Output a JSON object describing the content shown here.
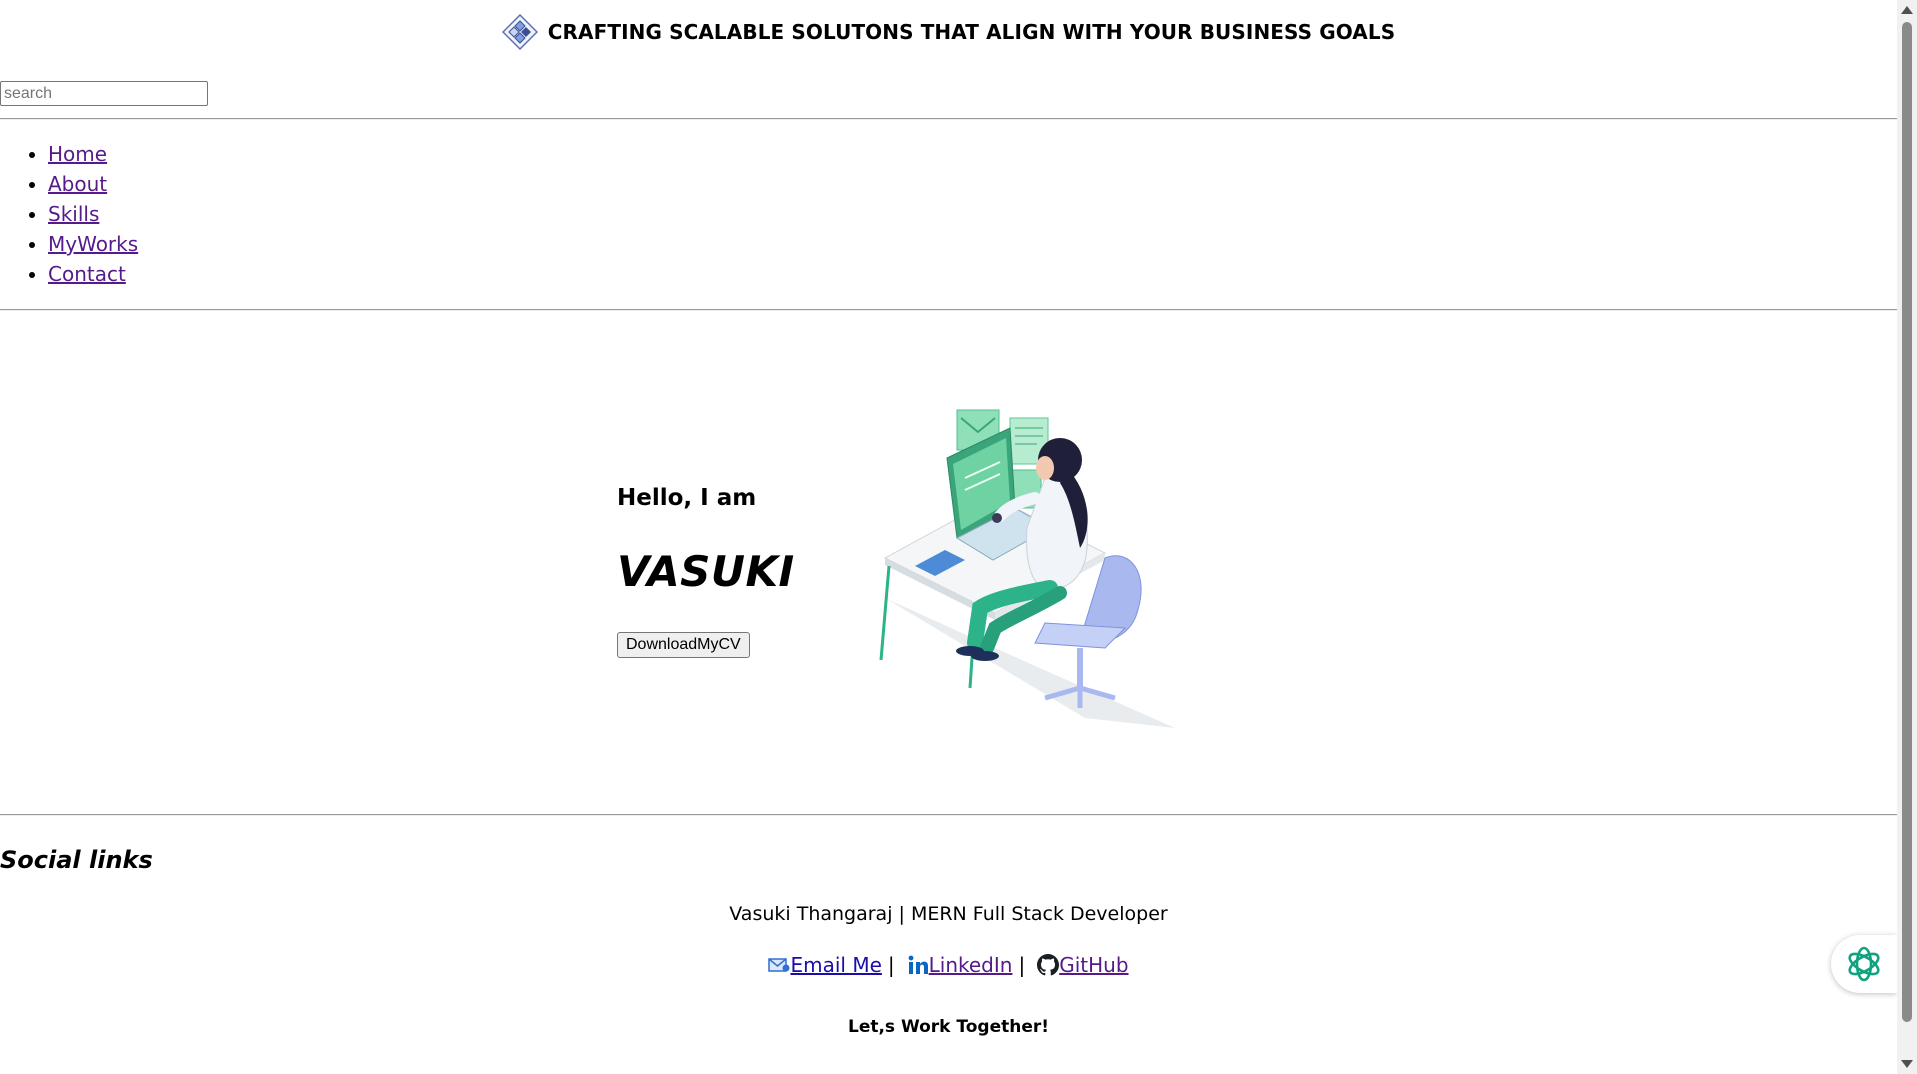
{
  "header": {
    "tagline": "CRAFTING SCALABLE SOLUTONS THAT ALIGN WITH YOUR BUSINESS GOALS",
    "logo_icon": "diamond-logo-icon"
  },
  "search": {
    "placeholder": "search",
    "value": ""
  },
  "nav": {
    "items": [
      {
        "label": "Home"
      },
      {
        "label": "About"
      },
      {
        "label": "Skills"
      },
      {
        "label": "MyWorks"
      },
      {
        "label": "Contact"
      }
    ]
  },
  "hero": {
    "greeting": "Hello, I am",
    "name": "VASUKI",
    "download_label": "DownloadMyCV",
    "illustration_icon": "person-at-computer-illustration"
  },
  "footer": {
    "social_title": "Social links",
    "byline": "Vasuki Thangaraj | MERN Full Stack Developer",
    "links": [
      {
        "label": "Email Me",
        "icon": "email-icon"
      },
      {
        "label": "LinkedIn",
        "icon": "linkedin-icon"
      },
      {
        "label": "GitHub",
        "icon": "github-icon"
      }
    ],
    "separator": "|",
    "cta": "Let,s Work Together!"
  },
  "assistant": {
    "icon": "openai-assistant-icon"
  },
  "colors": {
    "link": "#1a0dab",
    "visited_link": "#551a8b",
    "rule": "#9a9a9a",
    "assistant_accent": "#10a37f"
  }
}
